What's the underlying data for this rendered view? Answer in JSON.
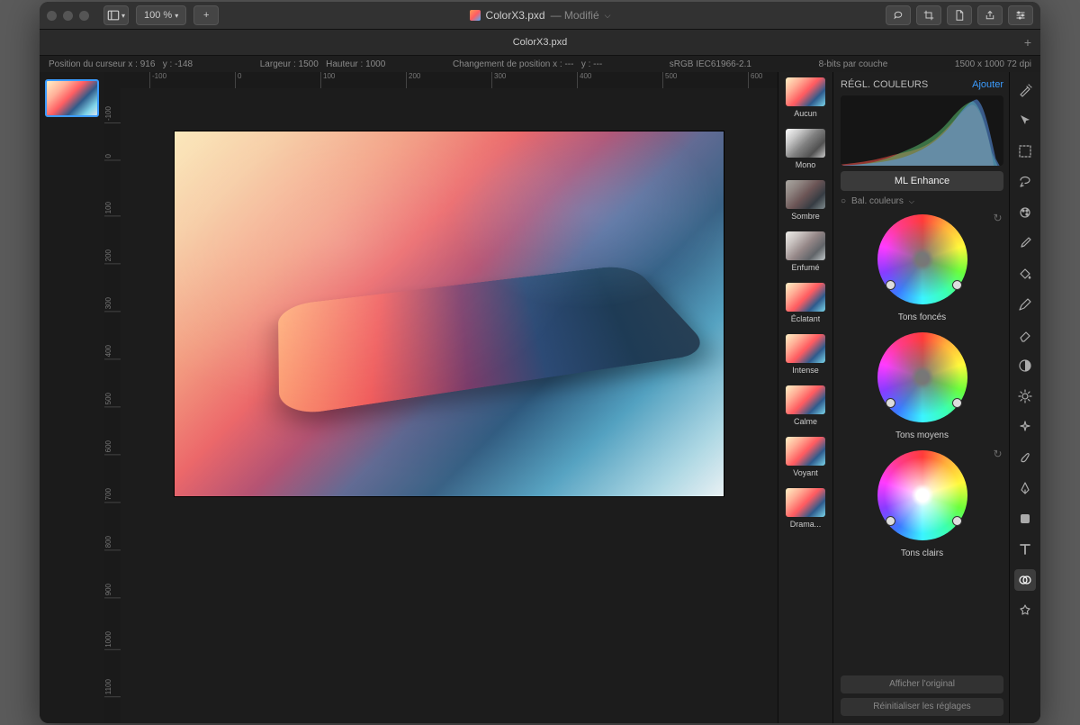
{
  "titlebar": {
    "zoom": "100 %",
    "filename": "ColorX3.pxd",
    "status": "— Modifié"
  },
  "tabbar": {
    "tab": "ColorX3.pxd"
  },
  "infobar": {
    "cursor_label": "Position du curseur x :",
    "cursor_x": "916",
    "cursor_y_label": "y :",
    "cursor_y": "-148",
    "size_w_label": "Largeur :",
    "size_w": "1500",
    "size_h_label": "Hauteur :",
    "size_h": "1000",
    "delta_label": "Changement de position x :",
    "delta_x": "---",
    "delta_y_label": "y :",
    "delta_y": "---",
    "profile": "sRGB IEC61966-2.1",
    "depth": "8-bits par couche",
    "dims": "1500  x 1000 72 dpi"
  },
  "presets": [
    {
      "label": "Aucun",
      "cls": "none"
    },
    {
      "label": "Mono",
      "cls": "mono"
    },
    {
      "label": "Sombre",
      "cls": "sombre"
    },
    {
      "label": "Enfumé",
      "cls": "enfume"
    },
    {
      "label": "Éclatant",
      "cls": "none"
    },
    {
      "label": "Intense",
      "cls": "none"
    },
    {
      "label": "Calme",
      "cls": "none"
    },
    {
      "label": "Voyant",
      "cls": "none"
    },
    {
      "label": "Drama...",
      "cls": "none"
    }
  ],
  "adjust": {
    "header": "RÉGL. COULEURS",
    "add": "Ajouter",
    "ml": "ML Enhance",
    "section": "Bal. couleurs",
    "wheels": [
      "Tons foncés",
      "Tons moyens",
      "Tons clairs"
    ],
    "show_original": "Afficher l'original",
    "reset": "Réinitialiser les réglages"
  },
  "ruler_top": [
    "-100",
    "0",
    "100",
    "200",
    "300",
    "400",
    "500",
    "600"
  ],
  "ruler_left": [
    "-100",
    "0",
    "100",
    "200",
    "300",
    "400",
    "500",
    "600",
    "700",
    "800",
    "900",
    "1000",
    "1100"
  ]
}
